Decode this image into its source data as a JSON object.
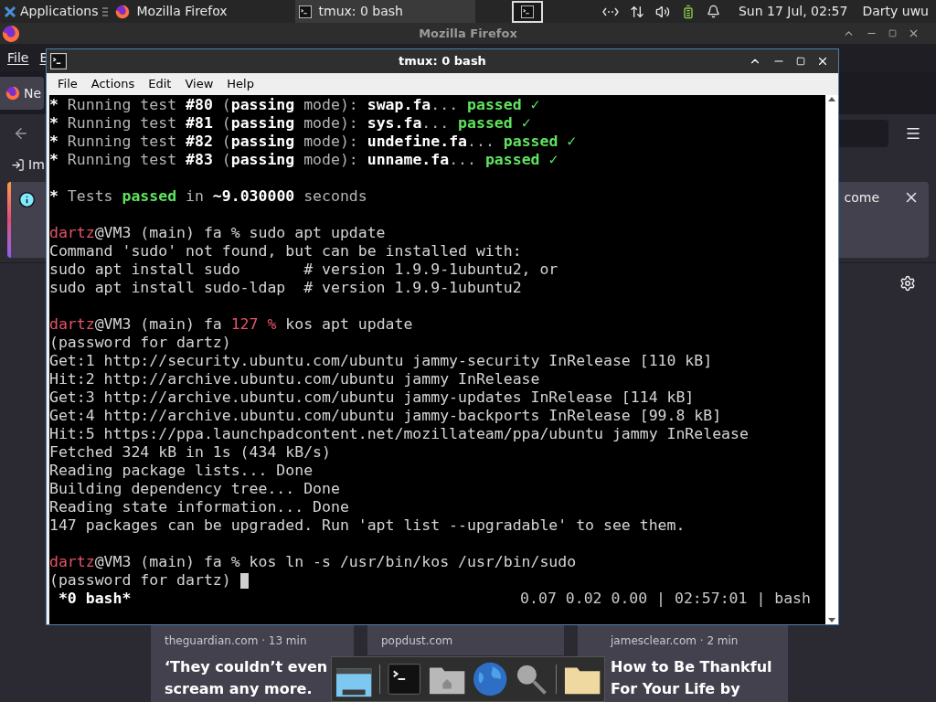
{
  "top_panel": {
    "menu_label": "Applications",
    "tasks": [
      {
        "title": "Mozilla Firefox",
        "kind": "browser",
        "selected": false
      },
      {
        "title": "tmux: 0 bash",
        "kind": "terminal",
        "selected": true
      }
    ],
    "clock": "Sun 17 Jul, 02:57",
    "user": "Darty uwu"
  },
  "firefox": {
    "title": "Mozilla Firefox",
    "menu": [
      "File",
      "E"
    ],
    "tab": "Ne",
    "bookmark": "Im",
    "notification": {
      "text": "come"
    },
    "cards": [
      {
        "source": "theguardian.com · 13 min",
        "headline": [
          "‘They couldn’t even",
          "scream any more."
        ]
      },
      {
        "source": "popdust.com"
      },
      {
        "source": "jamesclear.com · 2 min",
        "headline": [
          "How to Be Thankful",
          "For Your Life by"
        ]
      }
    ]
  },
  "terminal": {
    "title": "tmux: 0 bash",
    "menu": [
      "File",
      "Actions",
      "Edit",
      "View",
      "Help"
    ],
    "lines": [
      {
        "kind": "text",
        "segments": [
          {
            "kind": "bold",
            "t": "*"
          },
          {
            "kind": "dim",
            "t": " Running test "
          },
          {
            "kind": "bold",
            "t": "#80"
          },
          {
            "kind": "dim",
            "t": " ("
          },
          {
            "kind": "bold",
            "t": "passing"
          },
          {
            "kind": "dim",
            "t": " mode): "
          },
          {
            "kind": "bold",
            "t": "swap.fa"
          },
          {
            "kind": "dim",
            "t": "... "
          },
          {
            "kind": "green",
            "t": "passed"
          },
          {
            "kind": "check",
            "t": " ✓"
          }
        ]
      },
      {
        "kind": "text",
        "segments": [
          {
            "kind": "bold",
            "t": "*"
          },
          {
            "kind": "dim",
            "t": " Running test "
          },
          {
            "kind": "bold",
            "t": "#81"
          },
          {
            "kind": "dim",
            "t": " ("
          },
          {
            "kind": "bold",
            "t": "passing"
          },
          {
            "kind": "dim",
            "t": " mode): "
          },
          {
            "kind": "bold",
            "t": "sys.fa"
          },
          {
            "kind": "dim",
            "t": "... "
          },
          {
            "kind": "green",
            "t": "passed"
          },
          {
            "kind": "check",
            "t": " ✓"
          }
        ]
      },
      {
        "kind": "text",
        "segments": [
          {
            "kind": "bold",
            "t": "*"
          },
          {
            "kind": "dim",
            "t": " Running test "
          },
          {
            "kind": "bold",
            "t": "#82"
          },
          {
            "kind": "dim",
            "t": " ("
          },
          {
            "kind": "bold",
            "t": "passing"
          },
          {
            "kind": "dim",
            "t": " mode): "
          },
          {
            "kind": "bold",
            "t": "undefine.fa"
          },
          {
            "kind": "dim",
            "t": "... "
          },
          {
            "kind": "green",
            "t": "passed"
          },
          {
            "kind": "check",
            "t": " ✓"
          }
        ]
      },
      {
        "kind": "text",
        "segments": [
          {
            "kind": "bold",
            "t": "*"
          },
          {
            "kind": "dim",
            "t": " Running test "
          },
          {
            "kind": "bold",
            "t": "#83"
          },
          {
            "kind": "dim",
            "t": " ("
          },
          {
            "kind": "bold",
            "t": "passing"
          },
          {
            "kind": "dim",
            "t": " mode): "
          },
          {
            "kind": "bold",
            "t": "unname.fa"
          },
          {
            "kind": "dim",
            "t": "... "
          },
          {
            "kind": "green",
            "t": "passed"
          },
          {
            "kind": "check",
            "t": " ✓"
          }
        ]
      },
      {
        "kind": "blank"
      },
      {
        "kind": "text",
        "segments": [
          {
            "kind": "bold",
            "t": "*"
          },
          {
            "kind": "dim",
            "t": " Tests "
          },
          {
            "kind": "green",
            "t": "passed"
          },
          {
            "kind": "dim",
            "t": " in "
          },
          {
            "kind": "bold",
            "t": "~9.030000"
          },
          {
            "kind": "dim",
            "t": " seconds"
          }
        ]
      },
      {
        "kind": "blank"
      },
      {
        "kind": "text",
        "segments": [
          {
            "kind": "user",
            "t": "dartz"
          },
          {
            "kind": "plain",
            "t": "@VM3 (main) fa % sudo apt update"
          }
        ]
      },
      {
        "kind": "text",
        "segments": [
          {
            "kind": "plain",
            "t": "Command 'sudo' not found, but can be installed with:"
          }
        ]
      },
      {
        "kind": "text",
        "segments": [
          {
            "kind": "plain",
            "t": "sudo apt install sudo       # version 1.9.9-1ubuntu2, or"
          }
        ]
      },
      {
        "kind": "text",
        "segments": [
          {
            "kind": "plain",
            "t": "sudo apt install sudo-ldap  # version 1.9.9-1ubuntu2"
          }
        ]
      },
      {
        "kind": "blank"
      },
      {
        "kind": "text",
        "segments": [
          {
            "kind": "user",
            "t": "dartz"
          },
          {
            "kind": "plain",
            "t": "@VM3 (main) fa "
          },
          {
            "kind": "error",
            "t": "127 %"
          },
          {
            "kind": "plain",
            "t": " kos apt update"
          }
        ]
      },
      {
        "kind": "text",
        "segments": [
          {
            "kind": "plain",
            "t": "(password for dartz)"
          }
        ]
      },
      {
        "kind": "text",
        "segments": [
          {
            "kind": "plain",
            "t": "Get:1 http://security.ubuntu.com/ubuntu jammy-security InRelease [110 kB]"
          }
        ]
      },
      {
        "kind": "text",
        "segments": [
          {
            "kind": "plain",
            "t": "Hit:2 http://archive.ubuntu.com/ubuntu jammy InRelease"
          }
        ]
      },
      {
        "kind": "text",
        "segments": [
          {
            "kind": "plain",
            "t": "Get:3 http://archive.ubuntu.com/ubuntu jammy-updates InRelease [114 kB]"
          }
        ]
      },
      {
        "kind": "text",
        "segments": [
          {
            "kind": "plain",
            "t": "Get:4 http://archive.ubuntu.com/ubuntu jammy-backports InRelease [99.8 kB]"
          }
        ]
      },
      {
        "kind": "text",
        "segments": [
          {
            "kind": "plain",
            "t": "Hit:5 https://ppa.launchpadcontent.net/mozillateam/ppa/ubuntu jammy InRelease"
          }
        ]
      },
      {
        "kind": "text",
        "segments": [
          {
            "kind": "plain",
            "t": "Fetched 324 kB in 1s (434 kB/s)"
          }
        ]
      },
      {
        "kind": "text",
        "segments": [
          {
            "kind": "plain",
            "t": "Reading package lists... Done"
          }
        ]
      },
      {
        "kind": "text",
        "segments": [
          {
            "kind": "plain",
            "t": "Building dependency tree... Done"
          }
        ]
      },
      {
        "kind": "text",
        "segments": [
          {
            "kind": "plain",
            "t": "Reading state information... Done"
          }
        ]
      },
      {
        "kind": "text",
        "segments": [
          {
            "kind": "plain",
            "t": "147 packages can be upgraded. Run 'apt list --upgradable' to see them."
          }
        ]
      },
      {
        "kind": "blank"
      },
      {
        "kind": "text",
        "segments": [
          {
            "kind": "user",
            "t": "dartz"
          },
          {
            "kind": "plain",
            "t": "@VM3 (main) fa % kos ln -s /usr/bin/kos /usr/bin/sudo"
          }
        ]
      },
      {
        "kind": "text",
        "segments": [
          {
            "kind": "plain",
            "t": "(password for dartz) "
          }
        ]
      }
    ],
    "cursor": true,
    "status": {
      "left": " *0 bash*",
      "right": "0.07 0.02 0.00 | 02:57:01 | bash"
    }
  }
}
